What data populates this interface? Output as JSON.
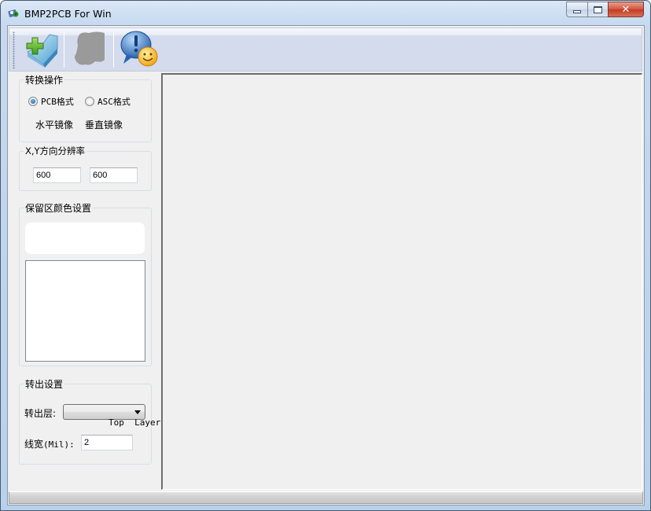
{
  "window": {
    "title": "BMP2PCB For Win",
    "controls": {
      "minimize": "minimize",
      "maximize": "maximize",
      "close": "close"
    }
  },
  "toolbar": {
    "buttons": [
      {
        "name": "open-file",
        "icon": "folder-add-icon",
        "enabled": true
      },
      {
        "name": "pcb-shape",
        "icon": "shape-silhouette-icon",
        "enabled": false
      },
      {
        "name": "about",
        "icon": "info-smiley-icon",
        "enabled": true
      }
    ]
  },
  "convert_ops": {
    "legend": "转换操作",
    "radio_pcb": "PCB格式",
    "radio_asc": "ASC格式",
    "selected": "PCB格式",
    "mirror_h": "水平镜像",
    "mirror_v": "垂直镜像"
  },
  "resolution": {
    "legend": "X,Y方向分辨率",
    "x_value": "600",
    "y_value": "600"
  },
  "reserve_color": {
    "legend": "保留区颜色设置",
    "color_preview": "",
    "color_list": []
  },
  "output": {
    "legend": "转出设置",
    "layer_label": "转出层:",
    "layer_value": "Top  Layer",
    "width_label_cn": "线宽",
    "width_label_unit": "(Mil):",
    "width_value": "2"
  },
  "status": {
    "text": ""
  },
  "colors": {
    "titlebar": "#c6d9ef",
    "client_bg": "#f0f0f0",
    "toolbar_bg": "#d3dbed",
    "close_button": "#c23a20",
    "radio_selected": "#1560a8"
  }
}
